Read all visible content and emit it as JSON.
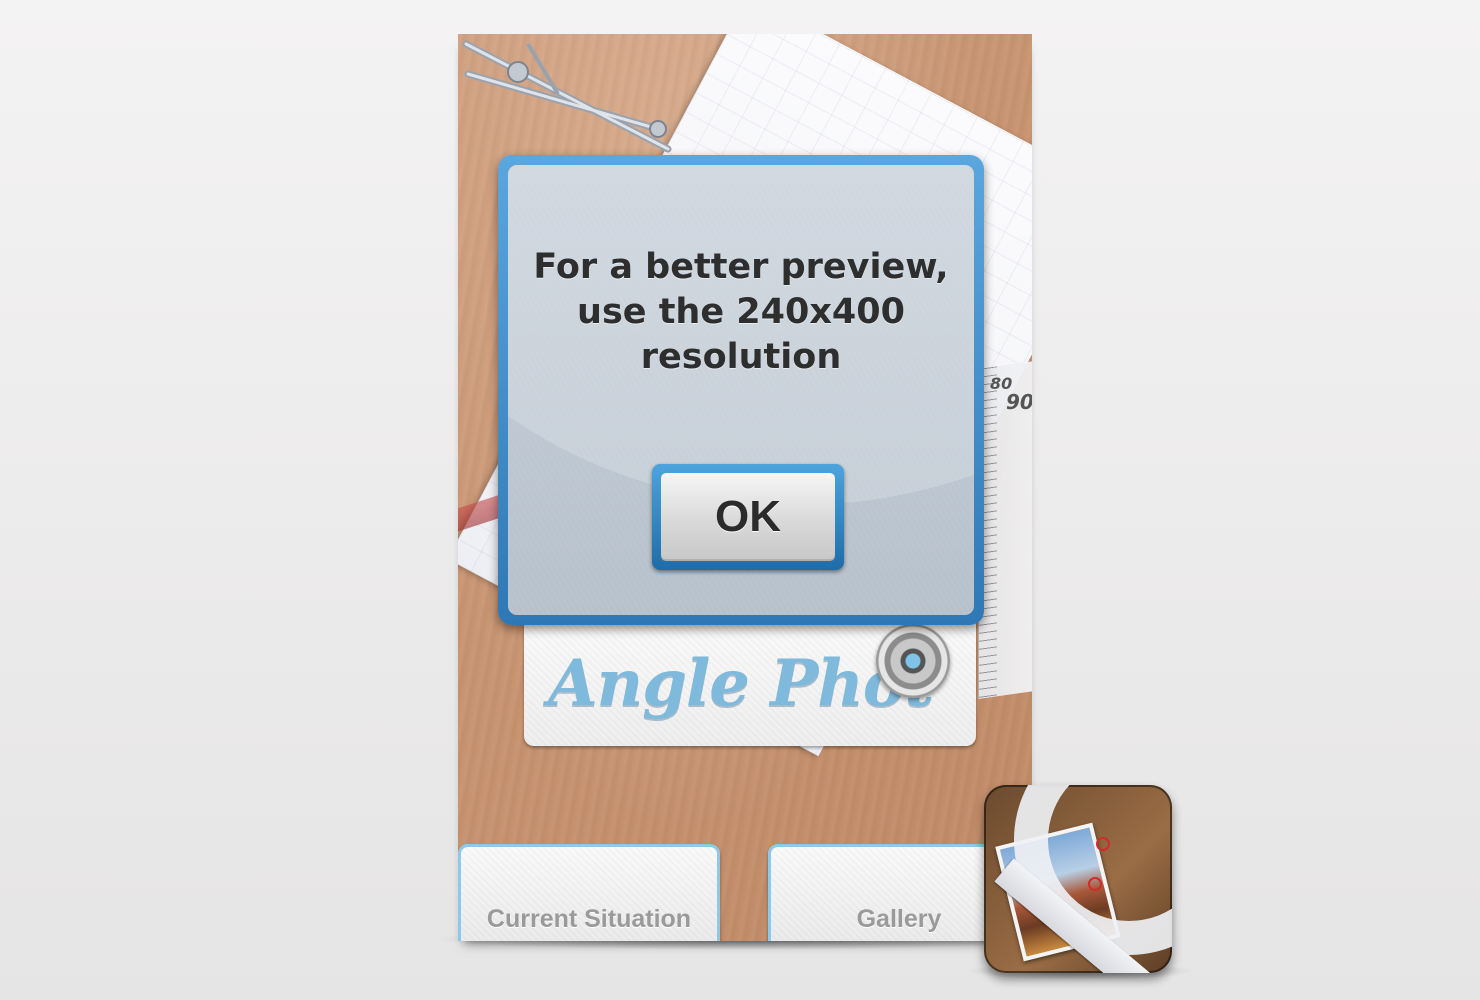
{
  "dialog": {
    "message": "For a better preview,\nuse the 240x400\nresolution",
    "ok_label": "OK"
  },
  "logo": {
    "text": "Angle Phot"
  },
  "bottom_buttons": {
    "current_situation": "Current Situation",
    "gallery": "Gallery"
  },
  "ruler": {
    "labels": [
      "80",
      "90"
    ]
  },
  "colors": {
    "dialog_border": "#3d8fd0",
    "dialog_fill": "#bfc8d2",
    "logo_text": "#7fb9dc",
    "button_border": "#8cc9ea",
    "background": "#efeeee"
  },
  "icons": {
    "app_icon": "angle-photo-app-icon",
    "lens": "camera-lens-icon"
  }
}
